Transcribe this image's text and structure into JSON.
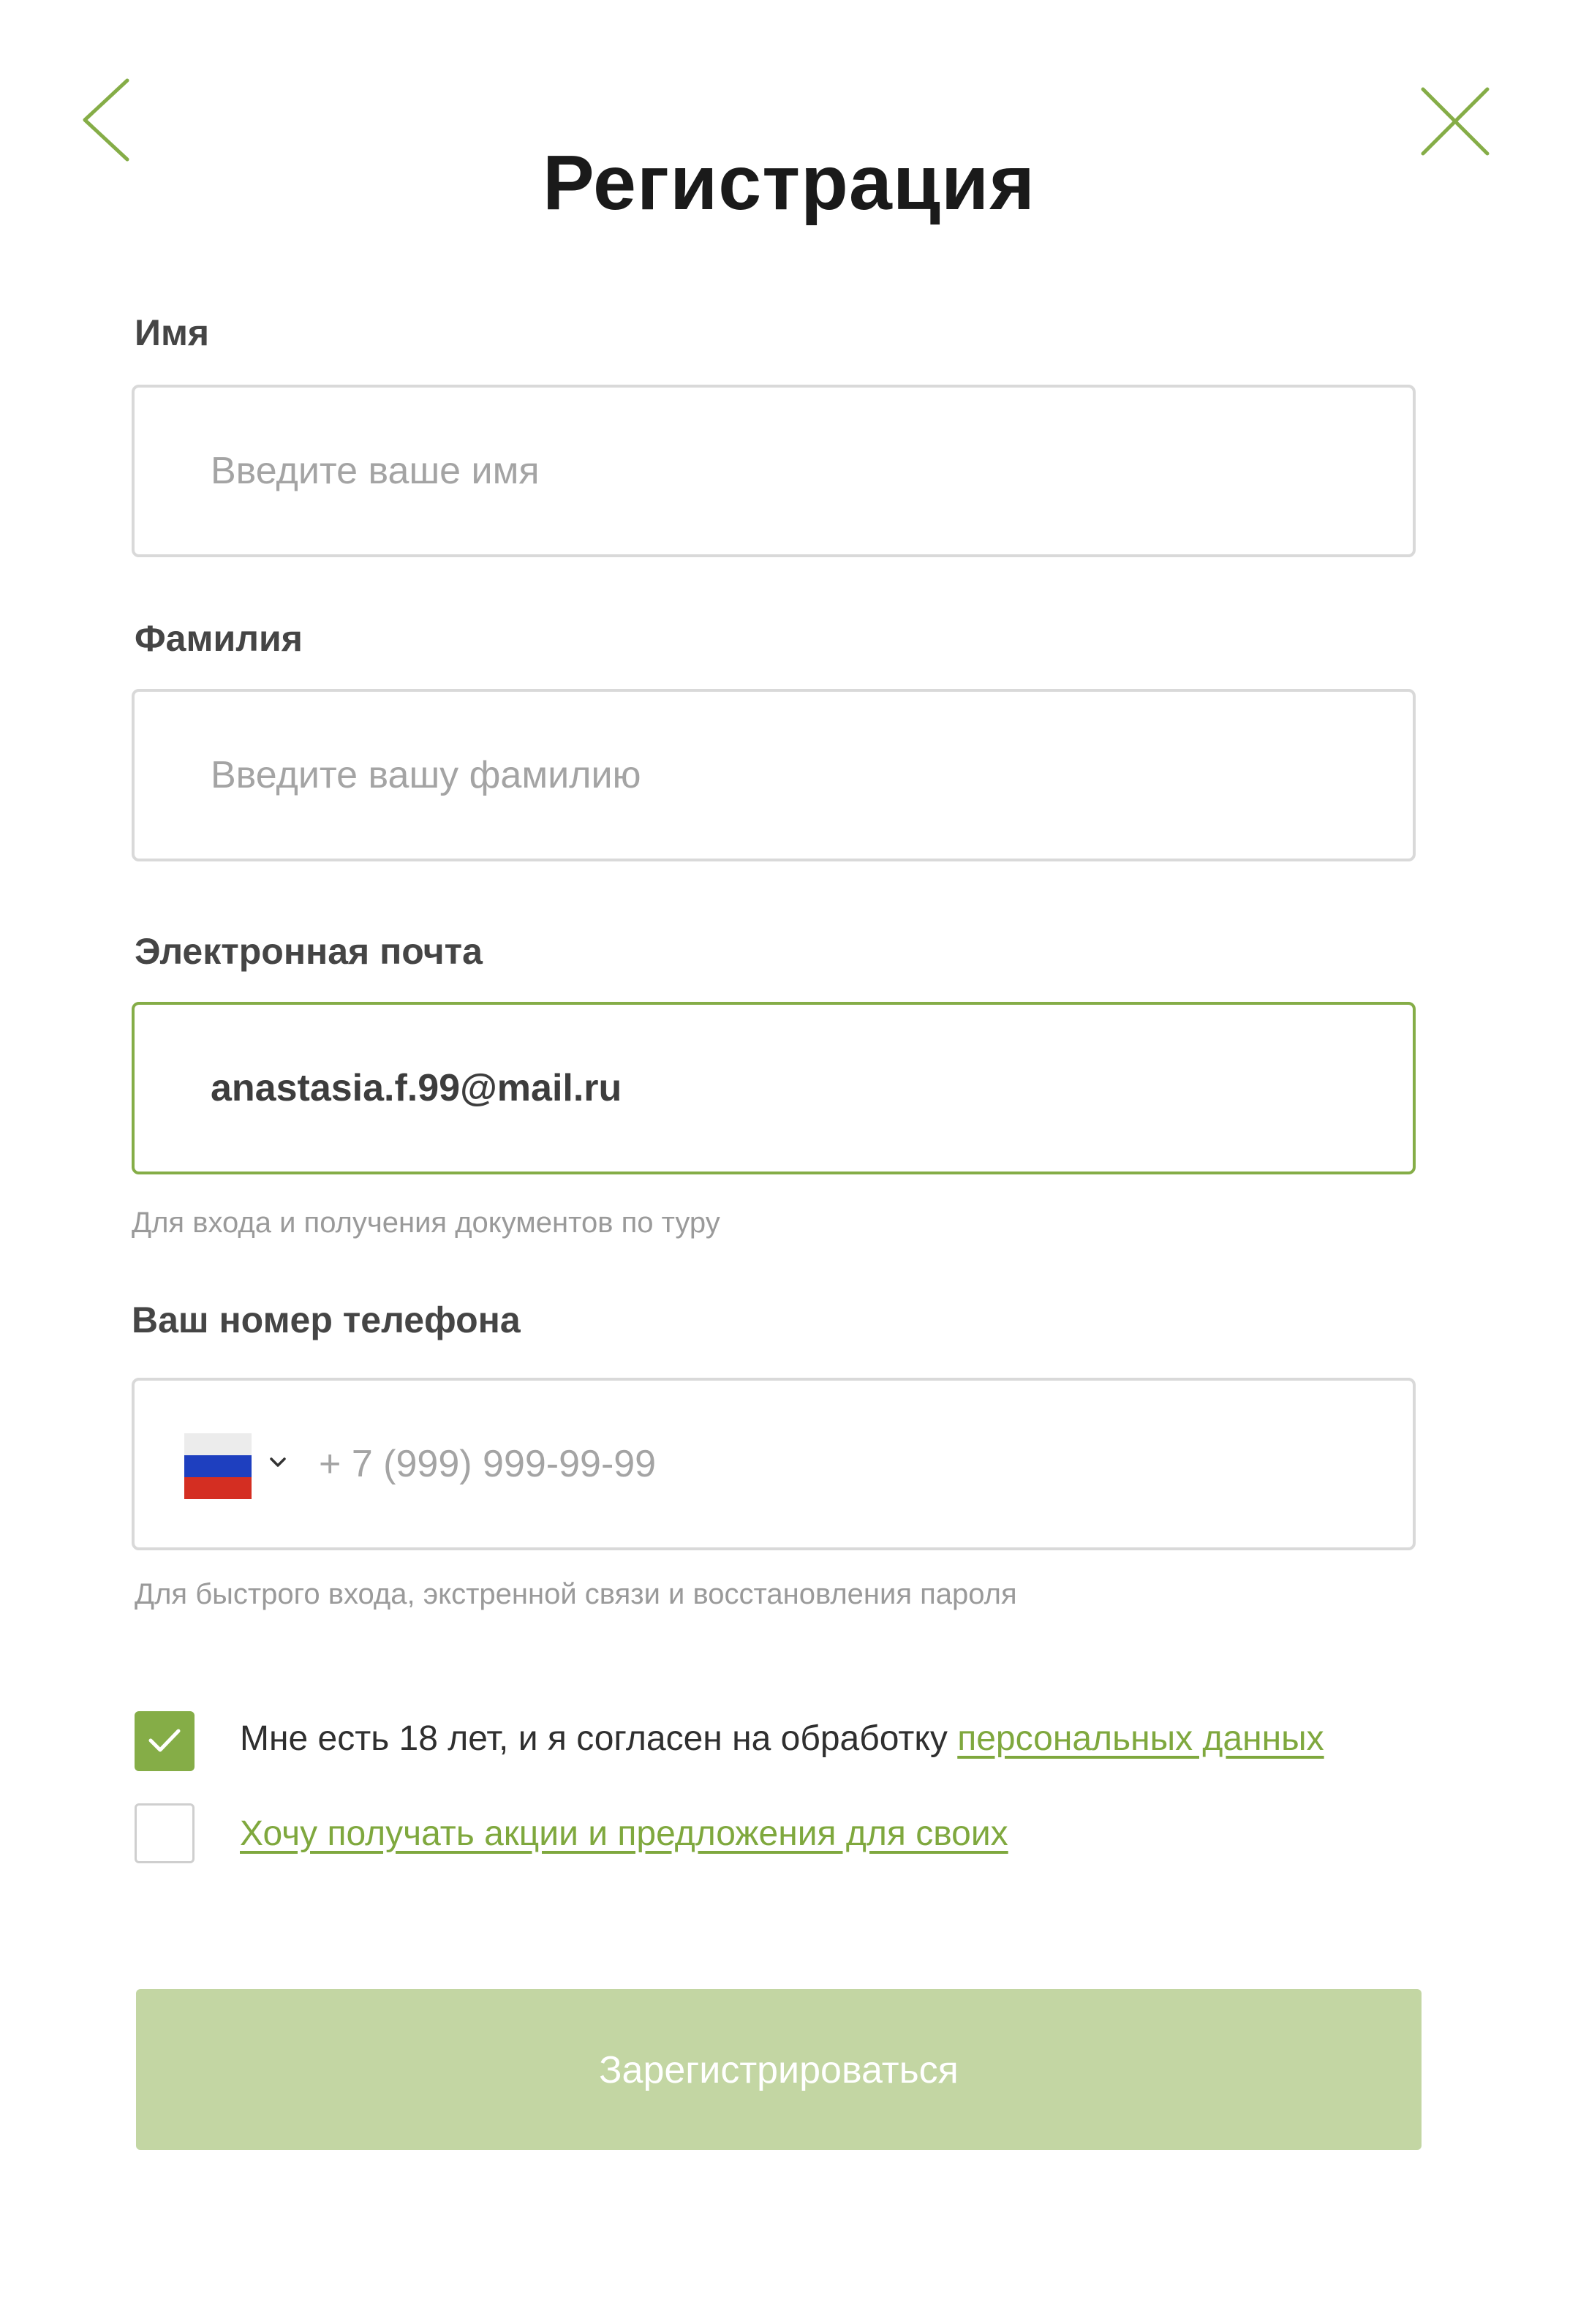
{
  "header": {
    "back_icon": "chevron-left-icon",
    "close_icon": "close-icon",
    "title": "Регистрация"
  },
  "form": {
    "first_name": {
      "label": "Имя",
      "placeholder": "Введите ваше имя",
      "value": ""
    },
    "last_name": {
      "label": "Фамилия",
      "placeholder": "Введите вашу фамилию",
      "value": ""
    },
    "email": {
      "label": "Электронная почта",
      "value": "anastasia.f.99@mail.ru",
      "hint": "Для входа и получения документов по туру"
    },
    "phone": {
      "label": "Ваш номер телефона",
      "placeholder": "+ 7 (999) 999-99-99",
      "value": "",
      "country_flag": "russia-flag-icon",
      "hint": "Для быстрого входа, экстренной связи и восстановления пароля"
    },
    "consent": {
      "checked": true,
      "text": "Мне есть 18 лет, и я согласен на обработку ",
      "link_text": "персональных данных"
    },
    "promo": {
      "checked": false,
      "link_text": "Хочу получать акции и предложения для своих"
    },
    "submit_label": "Зарегистрироваться"
  },
  "colors": {
    "accent": "#85ad47",
    "link": "#7fa83e",
    "button_disabled": "#c3d6a3",
    "border": "#d9d9d9"
  }
}
